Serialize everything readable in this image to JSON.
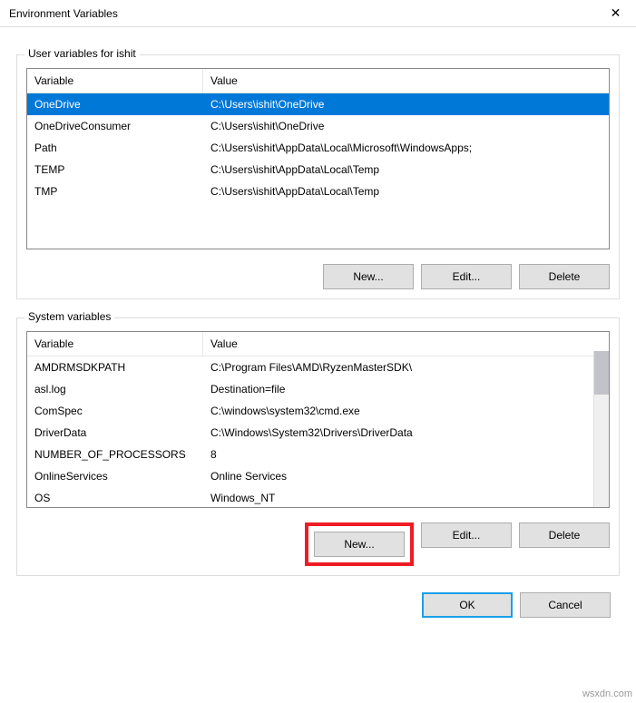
{
  "window": {
    "title": "Environment Variables",
    "close_glyph": "✕"
  },
  "user_section": {
    "label": "User variables for ishit",
    "headers": {
      "variable": "Variable",
      "value": "Value"
    },
    "rows": [
      {
        "variable": "OneDrive",
        "value": "C:\\Users\\ishit\\OneDrive"
      },
      {
        "variable": "OneDriveConsumer",
        "value": "C:\\Users\\ishit\\OneDrive"
      },
      {
        "variable": "Path",
        "value": "C:\\Users\\ishit\\AppData\\Local\\Microsoft\\WindowsApps;"
      },
      {
        "variable": "TEMP",
        "value": "C:\\Users\\ishit\\AppData\\Local\\Temp"
      },
      {
        "variable": "TMP",
        "value": "C:\\Users\\ishit\\AppData\\Local\\Temp"
      }
    ],
    "selected_index": 0,
    "buttons": {
      "new": "New...",
      "edit": "Edit...",
      "delete": "Delete"
    }
  },
  "system_section": {
    "label": "System variables",
    "headers": {
      "variable": "Variable",
      "value": "Value"
    },
    "rows": [
      {
        "variable": "AMDRMSDKPATH",
        "value": "C:\\Program Files\\AMD\\RyzenMasterSDK\\"
      },
      {
        "variable": "asl.log",
        "value": "Destination=file"
      },
      {
        "variable": "ComSpec",
        "value": "C:\\windows\\system32\\cmd.exe"
      },
      {
        "variable": "DriverData",
        "value": "C:\\Windows\\System32\\Drivers\\DriverData"
      },
      {
        "variable": "NUMBER_OF_PROCESSORS",
        "value": "8"
      },
      {
        "variable": "OnlineServices",
        "value": "Online Services"
      },
      {
        "variable": "OS",
        "value": "Windows_NT"
      }
    ],
    "buttons": {
      "new": "New...",
      "edit": "Edit...",
      "delete": "Delete"
    }
  },
  "footer": {
    "ok": "OK",
    "cancel": "Cancel"
  },
  "watermark": "wsxdn.com"
}
